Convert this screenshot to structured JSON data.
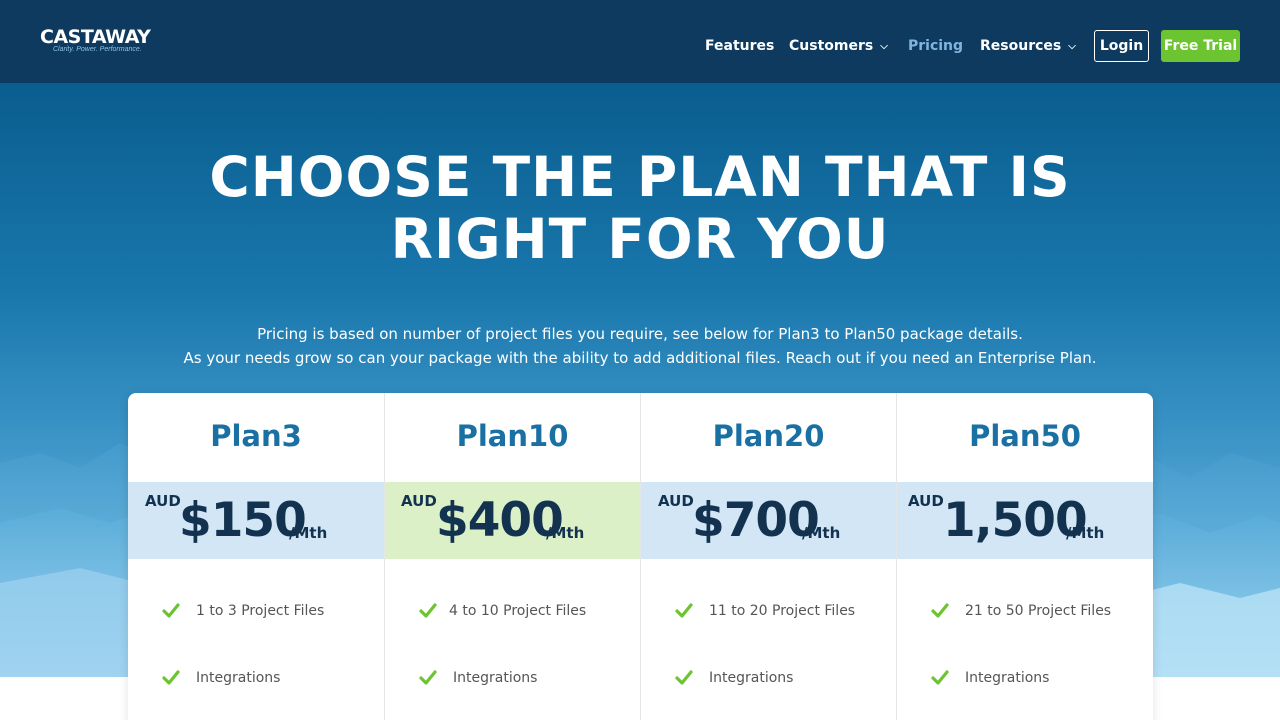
{
  "brand": {
    "name": "CASTAWAY",
    "tagline": "Clarity. Power. Performance."
  },
  "nav": {
    "features": "Features",
    "customers": "Customers",
    "pricing": "Pricing",
    "resources": "Resources",
    "login": "Login",
    "free_trial": "Free Trial"
  },
  "hero": {
    "title_line1": "CHOOSE THE PLAN THAT IS",
    "title_line2": "RIGHT FOR YOU",
    "desc_line1": "Pricing is based on number of project files you require, see below for Plan3 to Plan50 package details.",
    "desc_line2": "As your needs grow so can your package with the ability to add additional files. Reach out if you need an Enterprise Plan."
  },
  "plans": [
    {
      "name": "Plan3",
      "currency": "AUD",
      "amount": "$150",
      "period": "/Mth",
      "features": [
        "1 to 3 Project Files",
        "Integrations"
      ]
    },
    {
      "name": "Plan10",
      "currency": "AUD",
      "amount": "$400",
      "period": "/Mth",
      "features": [
        "4 to 10 Project Files",
        "Integrations"
      ]
    },
    {
      "name": "Plan20",
      "currency": "AUD",
      "amount": "$700",
      "period": "/Mth",
      "features": [
        "11 to 20 Project Files",
        "Integrations"
      ]
    },
    {
      "name": "Plan50",
      "currency": "AUD",
      "amount": "1,500",
      "period": "/Mth",
      "features": [
        "21 to 50 Project Files",
        "Integrations"
      ]
    }
  ],
  "icons": {
    "chevron": "chevron-down-icon",
    "check": "check-icon"
  },
  "colors": {
    "header_bg": "#0d3a5e",
    "accent_green": "#6cc430",
    "plan_title": "#1a6fa3",
    "price_band": "#d2e6f6",
    "price_band_featured": "#dcf0c8",
    "check": "#6cc430"
  }
}
